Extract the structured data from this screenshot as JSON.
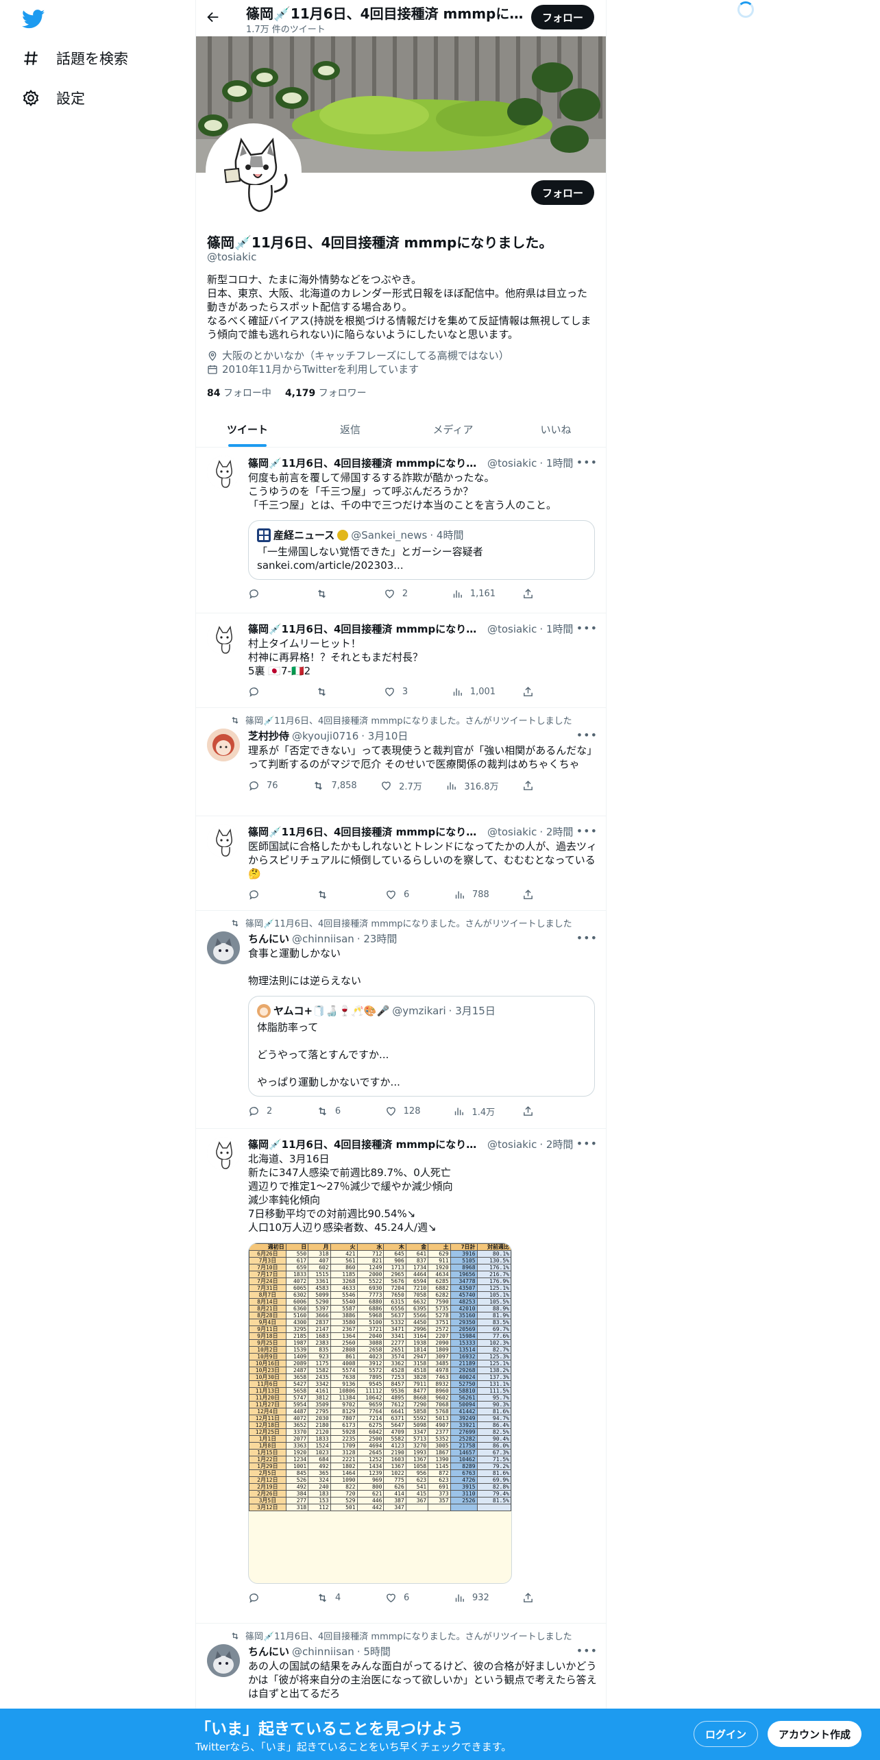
{
  "nav": {
    "items": [
      {
        "label": "話題を検索",
        "icon": "hashtag-icon"
      },
      {
        "label": "設定",
        "icon": "gear-icon"
      }
    ]
  },
  "header": {
    "name": "篠岡💉11月6日、4回目接種済 mmmpになりました。",
    "tweet_count": "1.7万 件のツイート",
    "follow_label": "フォロー"
  },
  "profile": {
    "name": "篠岡💉11月6日、4回目接種済 mmmpになりました。",
    "handle": "@tosiakic",
    "bio": "新型コロナ、たまに海外情勢などをつぶやき。\n日本、東京、大阪、北海道のカレンダー形式日報をほぼ配信中。他府県は目立った動きがあったらスポット配信する場合あり。\nなるべく確証バイアス(持説を根拠づける情報だけを集めて反証情報は無視してしまう傾向で誰も逃れられない)に陥らないようにしたいなと思います。",
    "location": "大阪のとかいなか（キャッチフレーズにしてる高槻ではない）",
    "joined": "2010年11月からTwitterを利用しています",
    "following_count": "84",
    "following_label": "フォロー中",
    "followers_count": "4,179",
    "followers_label": "フォロワー",
    "follow_label": "フォロー"
  },
  "tabs": [
    "ツイート",
    "返信",
    "メディア",
    "いいね"
  ],
  "tweets": [
    {
      "name": "篠岡💉11月6日、4回目接種済 mmmpになりました。",
      "handle": "@tosiakic",
      "time": "· 1時間",
      "text": "何度も前言を覆して帰国するする詐欺が酷かったな。\nこうゆうのを「千三つ屋」って呼ぶんだろうか？\n「千三つ屋」とは、千の中で三つだけ本当のことを言う人のこと。",
      "quote": {
        "name": "産経ニュース",
        "handle": "@Sankei_news",
        "time": "· 4時間",
        "text": "「一生帰国しない覚悟できた」とガーシー容疑者\nsankei.com/article/202303..."
      },
      "replies": "",
      "retweets": "",
      "likes": "2",
      "views": "1,161"
    },
    {
      "name": "篠岡💉11月6日、4回目接種済 mmmpになりました。",
      "handle": "@tosiakic",
      "time": "· 1時間",
      "text": "村上タイムリーヒット！\n村神に再昇格！？それともまだ村長？\n5裏 🇯🇵7-🇮🇹2",
      "replies": "",
      "retweets": "",
      "likes": "3",
      "views": "1,001"
    },
    {
      "retweeted_by": "篠岡💉11月6日、4回目接種済 mmmpになりました。さんがリツイートしました",
      "name": "芝村抄侍",
      "handle": "@kyouji0716",
      "time": "· 3月10日",
      "text": "理系が「否定できない」って表現使うと裁判官が「強い相関があるんだな」って判断するのがマジで厄介 そのせいで医療関係の裁判はめちゃくちゃ",
      "replies": "76",
      "retweets": "7,858",
      "likes": "2.7万",
      "views": "316.8万"
    },
    {
      "name": "篠岡💉11月6日、4回目接種済 mmmpになりました。",
      "handle": "@tosiakic",
      "time": "· 2時間",
      "text": "医師国試に合格したかもしれないとトレンドになってたかの人が、過去ツィからスピリチュアルに傾倒しているらしいのを察して、むむむとなっている🤔",
      "replies": "",
      "retweets": "",
      "likes": "6",
      "views": "788"
    },
    {
      "retweeted_by": "篠岡💉11月6日、4回目接種済 mmmpになりました。さんがリツイートしました",
      "name": "ちんにい",
      "handle": "@chinniisan",
      "time": "· 23時間",
      "text": "食事と運動しかない\n\n物理法則には逆らえない",
      "quote": {
        "name": "ヤムコ+🧻🍶🍷🥂🎨🎤",
        "handle": "@ymzikari",
        "time": "· 3月15日",
        "text": "体脂肪率って\n\nどうやって落とすんですか...\n\nやっぱり運動しかないですか..."
      },
      "replies": "2",
      "retweets": "6",
      "likes": "128",
      "views": "1.4万"
    },
    {
      "name": "篠岡💉11月6日、4回目接種済 mmmpになりました。",
      "handle": "@tosiakic",
      "time": "· 2時間",
      "text": "北海道、3月16日\n新たに347人感染で前週比89.7%、0人死亡\n週辺りで推定1～27％減少で緩やか減少傾向\n減少率鈍化傾向\n7日移動平均での対前週比90.54%↘\n人口10万人辺り感染者数、45.24人/週↘",
      "replies": "",
      "retweets": "4",
      "likes": "6",
      "views": "932"
    },
    {
      "retweeted_by": "篠岡💉11月6日、4回目接種済 mmmpになりました。さんがリツイートしました",
      "name": "ちんにい",
      "handle": "@chinniisan",
      "time": "· 5時間",
      "text": "あの人の国試の結果をみんな面白がってるけど、彼の合格が好ましいかどうかは「彼が将来自分の主治医になって欲しいか」という観点で考えたら答えは自ずと出てるだろ"
    }
  ],
  "sheet": {
    "headers": [
      "週初日",
      "日",
      "月",
      "火",
      "水",
      "木",
      "金",
      "土",
      "7日計",
      "対前週比"
    ],
    "rows": [
      [
        "6月26日",
        "550",
        "318",
        "421",
        "712",
        "645",
        "641",
        "629",
        "3916",
        "80.1%"
      ],
      [
        "7月3日",
        "617",
        "407",
        "561",
        "821",
        "906",
        "837",
        "911",
        "5105",
        "130.5%"
      ],
      [
        "7月10日",
        "659",
        "602",
        "860",
        "1249",
        "1713",
        "1734",
        "1920",
        "8968",
        "176.1%"
      ],
      [
        "7月17日",
        "1833",
        "1515",
        "1185",
        "2000",
        "2965",
        "4464",
        "4634",
        "19656",
        "216.7%"
      ],
      [
        "7月24日",
        "4072",
        "3361",
        "3268",
        "5522",
        "5676",
        "6594",
        "6285",
        "34778",
        "176.9%"
      ],
      [
        "7月31日",
        "6065",
        "4583",
        "4633",
        "6930",
        "7204",
        "7210",
        "6882",
        "43507",
        "125.1%"
      ],
      [
        "8月7日",
        "6302",
        "5099",
        "5546",
        "7773",
        "7650",
        "7058",
        "6282",
        "45740",
        "105.1%"
      ],
      [
        "8月14日",
        "6006",
        "5290",
        "5540",
        "6880",
        "6315",
        "6632",
        "7590",
        "48253",
        "105.5%"
      ],
      [
        "8月21日",
        "6360",
        "5397",
        "5587",
        "6886",
        "6556",
        "6395",
        "5735",
        "42010",
        "88.9%"
      ],
      [
        "8月28日",
        "5160",
        "3666",
        "3886",
        "5968",
        "5637",
        "5566",
        "5278",
        "35160",
        "81.9%"
      ],
      [
        "9月4日",
        "4300",
        "2837",
        "3580",
        "5100",
        "5332",
        "4450",
        "3751",
        "29350",
        "83.5%"
      ],
      [
        "9月11日",
        "3295",
        "2147",
        "2367",
        "3721",
        "3471",
        "2996",
        "2572",
        "20569",
        "69.7%"
      ],
      [
        "9月18日",
        "2185",
        "1683",
        "1364",
        "2040",
        "3341",
        "3164",
        "2207",
        "15984",
        "77.6%"
      ],
      [
        "9月25日",
        "1987",
        "2383",
        "2560",
        "3088",
        "2277",
        "1938",
        "2090",
        "15333",
        "102.3%"
      ],
      [
        "10月2日",
        "1539",
        "835",
        "2808",
        "2658",
        "2651",
        "1814",
        "1809",
        "13514",
        "82.7%"
      ],
      [
        "10月9日",
        "1409",
        "923",
        "861",
        "4023",
        "3574",
        "2947",
        "3097",
        "16932",
        "125.3%"
      ],
      [
        "10月16日",
        "2089",
        "1175",
        "4008",
        "3912",
        "3362",
        "3158",
        "3485",
        "21189",
        "125.1%"
      ],
      [
        "10月23日",
        "2487",
        "1582",
        "5574",
        "5572",
        "4528",
        "4518",
        "4978",
        "29268",
        "138.2%"
      ],
      [
        "10月30日",
        "3658",
        "2435",
        "7638",
        "7895",
        "7253",
        "3828",
        "7463",
        "40024",
        "137.3%"
      ],
      [
        "11月6日",
        "5427",
        "3342",
        "9136",
        "9545",
        "8457",
        "7911",
        "8932",
        "52750",
        "131.1%"
      ],
      [
        "11月13日",
        "5658",
        "4161",
        "10806",
        "11112",
        "9536",
        "8477",
        "8960",
        "58810",
        "111.5%"
      ],
      [
        "11月20日",
        "5747",
        "3812",
        "11384",
        "10642",
        "4895",
        "8668",
        "9602",
        "56261",
        "95.7%"
      ],
      [
        "11月27日",
        "5954",
        "3509",
        "9702",
        "9659",
        "7612",
        "7290",
        "7068",
        "50094",
        "90.3%"
      ],
      [
        "12月4日",
        "4487",
        "2795",
        "8129",
        "7764",
        "6641",
        "5858",
        "5768",
        "41442",
        "81.6%"
      ],
      [
        "12月11日",
        "4072",
        "2030",
        "7807",
        "7214",
        "6371",
        "5592",
        "5013",
        "39249",
        "94.7%"
      ],
      [
        "12月18日",
        "3652",
        "2180",
        "6173",
        "6275",
        "5647",
        "5098",
        "4907",
        "33921",
        "86.4%"
      ],
      [
        "12月25日",
        "3370",
        "2120",
        "5928",
        "6042",
        "4709",
        "3347",
        "2377",
        "27699",
        "82.5%"
      ],
      [
        "1月1日",
        "2077",
        "1833",
        "2235",
        "2500",
        "5582",
        "5713",
        "5352",
        "25282",
        "90.4%"
      ],
      [
        "1月8日",
        "3363",
        "1524",
        "1709",
        "4694",
        "4123",
        "3270",
        "3005",
        "21758",
        "86.0%"
      ],
      [
        "1月15日",
        "1920",
        "1023",
        "3128",
        "2645",
        "2190",
        "1993",
        "1867",
        "14657",
        "67.3%"
      ],
      [
        "1月22日",
        "1234",
        "684",
        "2221",
        "1252",
        "1603",
        "1367",
        "1390",
        "10462",
        "71.5%"
      ],
      [
        "1月29日",
        "1001",
        "492",
        "1802",
        "1434",
        "1367",
        "1058",
        "1145",
        "8289",
        "79.2%"
      ],
      [
        "2月5日",
        "845",
        "365",
        "1464",
        "1239",
        "1022",
        "956",
        "872",
        "6763",
        "81.6%"
      ],
      [
        "2月12日",
        "526",
        "324",
        "1090",
        "969",
        "775",
        "623",
        "623",
        "4726",
        "69.9%"
      ],
      [
        "2月19日",
        "492",
        "240",
        "822",
        "800",
        "626",
        "541",
        "691",
        "3915",
        "82.8%"
      ],
      [
        "2月26日",
        "384",
        "183",
        "720",
        "621",
        "414",
        "415",
        "373",
        "3110",
        "79.4%"
      ],
      [
        "3月5日",
        "277",
        "153",
        "529",
        "446",
        "387",
        "367",
        "357",
        "2526",
        "81.5%"
      ],
      [
        "3月12日",
        "318",
        "112",
        "501",
        "442",
        "347",
        "",
        "",
        "",
        ""
      ]
    ]
  },
  "bottom": {
    "title": "「いま」起きていることを見つけよう",
    "subtitle": "Twitterなら、「いま」起きていることをいち早くチェックできます。",
    "login_label": "ログイン",
    "signup_label": "アカウント作成"
  }
}
